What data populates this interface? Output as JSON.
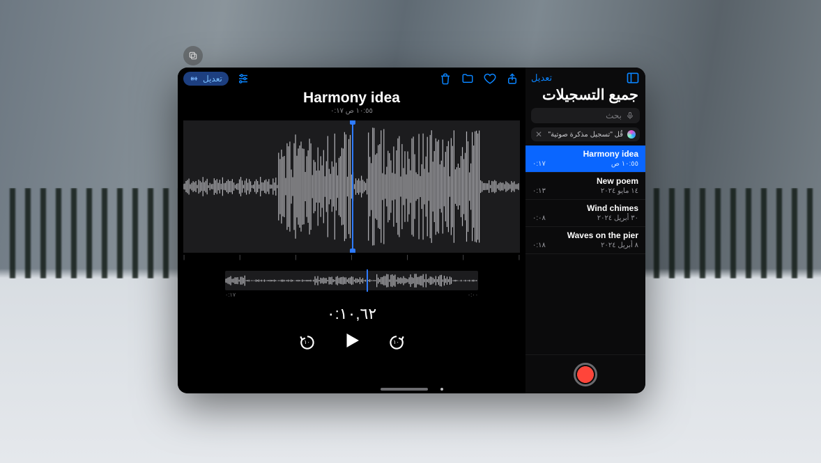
{
  "sidebar": {
    "edit_label": "تعديل",
    "title": "جميع التسجيلات",
    "search_placeholder": "بحث",
    "siri_hint": "قُل \"تسجيل مذكرة صوتية\"",
    "items": [
      {
        "title": "Harmony idea",
        "date": "١٠:٥٥ ص",
        "duration": "٠:١٧",
        "selected": true
      },
      {
        "title": "New poem",
        "date": "١٤ مايو ٢٠٢٤",
        "duration": "٠:١٣",
        "selected": false
      },
      {
        "title": "Wind chimes",
        "date": "٣٠ أبريل ٢٠٢٤",
        "duration": "٠:٠٨",
        "selected": false
      },
      {
        "title": "Waves on the pier",
        "date": "٨ أبريل ٢٠٢٤",
        "duration": "٠:١٨",
        "selected": false
      }
    ]
  },
  "editor": {
    "edit_pill": "تعديل",
    "title": "Harmony idea",
    "meta": "١٠:٥٥ ص   ٠:١٧",
    "mini_start": "٠:٠٠",
    "mini_end": "٠:١٧",
    "current_time": "٠:١٠,٦٢",
    "skip_back": "١٠",
    "skip_fwd": "١٠"
  }
}
